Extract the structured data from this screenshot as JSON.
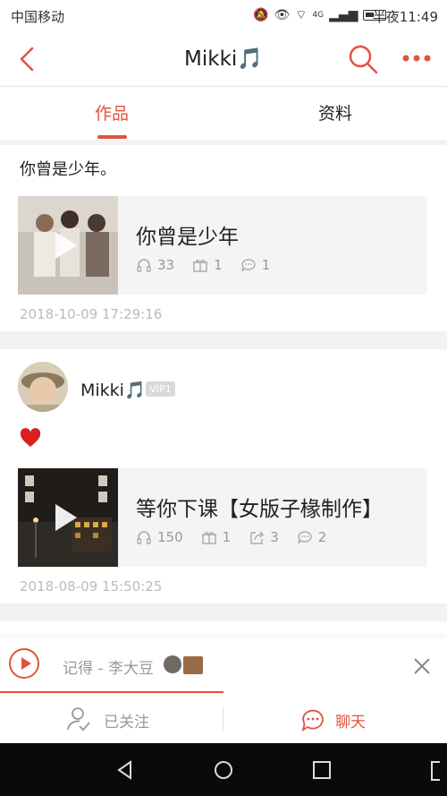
{
  "status_bar": {
    "carrier": "中国移动",
    "network": "4G",
    "time": "半夜11:49"
  },
  "header": {
    "title": "Mikki🎵"
  },
  "tabs": [
    {
      "label": "作品",
      "active": true
    },
    {
      "label": "资料",
      "active": false
    }
  ],
  "posts": [
    {
      "text": "你曾是少年。",
      "card": {
        "title": "你曾是少年",
        "stats": {
          "listens": "33",
          "gifts": "1",
          "comments": "1"
        }
      },
      "timestamp": "2018-10-09 17:29:16"
    },
    {
      "author": {
        "name": "Mikki🎵",
        "badge": "VIP1"
      },
      "text_icon": "heart-icon",
      "card": {
        "title": "等你下课【女版子椽制作】",
        "stats": {
          "listens": "150",
          "gifts": "1",
          "shares": "3",
          "comments": "2"
        }
      },
      "timestamp": "2018-08-09 15:50:25"
    }
  ],
  "player": {
    "track": "记得 - 李大豆"
  },
  "bottom_actions": {
    "follow": "已关注",
    "chat": "聊天"
  },
  "colors": {
    "accent": "#e0533f",
    "secondary_text": "#999999",
    "divider": "#f2f2f2"
  }
}
